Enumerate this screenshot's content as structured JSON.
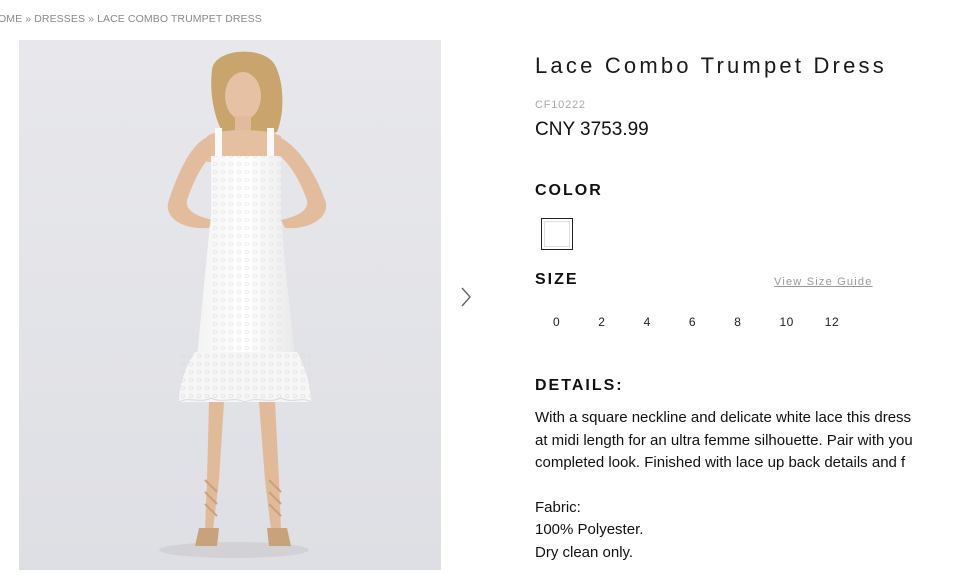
{
  "breadcrumb": {
    "home": "OME",
    "sep1": " » ",
    "dresses": "DRESSES",
    "sep2": " » ",
    "current": "LACE COMBO TRUMPET DRESS"
  },
  "gallery": {
    "next_icon": "chevron-right-icon"
  },
  "product": {
    "title": "Lace Combo Trumpet Dress",
    "sku": "CF10222",
    "price": "CNY 3753.99"
  },
  "color": {
    "label": "COLOR",
    "selected": "#ffffff"
  },
  "size": {
    "label": "SIZE",
    "guide_link": "View Size Guide",
    "options": [
      "0",
      "2",
      "4",
      "6",
      "8",
      "10",
      "12"
    ]
  },
  "details": {
    "label": "DETAILS:",
    "lines": [
      "With a square neckline and delicate white lace this dress",
      "at midi length for an ultra femme silhouette. Pair with you",
      "completed look. Finished with lace up back details and f"
    ],
    "fabric_label": "Fabric:",
    "fabric": "100% Polyester.",
    "care": "Dry clean only."
  }
}
